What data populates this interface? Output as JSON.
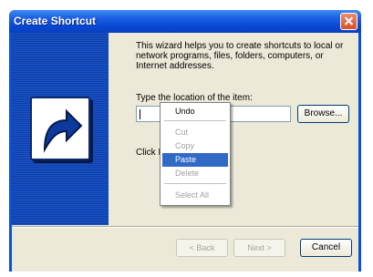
{
  "window": {
    "title": "Create Shortcut",
    "close_icon": "close-icon"
  },
  "banner": {
    "icon": "shortcut-arrow-icon"
  },
  "content": {
    "description": "This wizard helps you to create shortcuts to local or network programs, files, folders, computers, or Internet addresses.",
    "location_label": "Type the location of the item:",
    "location_value": "",
    "browse_label": "Browse...",
    "click_text": "Click N"
  },
  "buttons": {
    "back": "< Back",
    "next": "Next >",
    "cancel": "Cancel"
  },
  "context_menu": {
    "items": [
      {
        "label": "Undo",
        "enabled": true
      },
      {
        "label": "Cut",
        "enabled": false
      },
      {
        "label": "Copy",
        "enabled": false
      },
      {
        "label": "Paste",
        "enabled": true,
        "highlighted": true
      },
      {
        "label": "Delete",
        "enabled": false
      },
      {
        "label": "Select All",
        "enabled": false
      }
    ]
  },
  "colors": {
    "titlebar": "#0a50d8",
    "face": "#ece9d8",
    "highlight": "#316ac5"
  }
}
